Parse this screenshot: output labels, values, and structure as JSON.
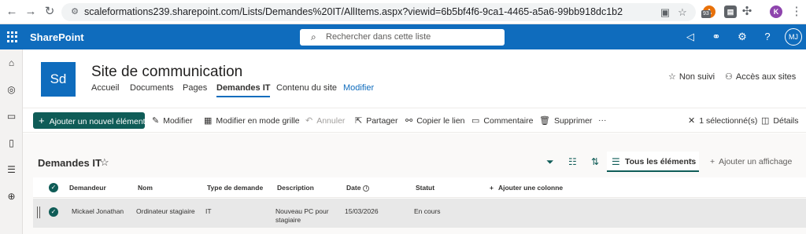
{
  "browser": {
    "url": "scaleformations239.sharepoint.com/Lists/Demandes%20IT/AllItems.aspx?viewid=6b5bf4f6-9ca1-4465-a5a6-99bb918dc1b2",
    "ext_badge": "93",
    "profile_initial": "K"
  },
  "suite": {
    "app_name": "SharePoint",
    "search_placeholder": "Rechercher dans cette liste",
    "avatar": "MJ",
    "brand_color": "#0f6cbd"
  },
  "site": {
    "logo_text": "Sd",
    "title": "Site de communication",
    "nav": [
      "Accueil",
      "Documents",
      "Pages",
      "Demandes IT",
      "Contenu du site",
      "Modifier"
    ],
    "follow": "Non suivi",
    "access": "Accès aux sites"
  },
  "commands": {
    "new_item": "Ajouter un nouvel élément",
    "edit": "Modifier",
    "grid_edit": "Modifier en mode grille",
    "undo": "Annuler",
    "share": "Partager",
    "copy_link": "Copier le lien",
    "comment": "Commentaire",
    "delete": "Supprimer",
    "more": "···",
    "selected": "1 sélectionné(s)",
    "details": "Détails"
  },
  "list": {
    "title": "Demandes IT",
    "view_name": "Tous les éléments",
    "add_view": "Ajouter un affichage",
    "columns": [
      "Demandeur",
      "Nom",
      "Type de demande",
      "Description",
      "Date",
      "Statut",
      "Ajouter une colonne"
    ],
    "rows": [
      {
        "demandeur": "Mickael Jonathan",
        "nom": "Ordinateur stagiaire",
        "type": "IT",
        "description": "Nouveau PC pour stagiaire",
        "date": "15/03/2026",
        "statut": "En cours"
      }
    ]
  }
}
